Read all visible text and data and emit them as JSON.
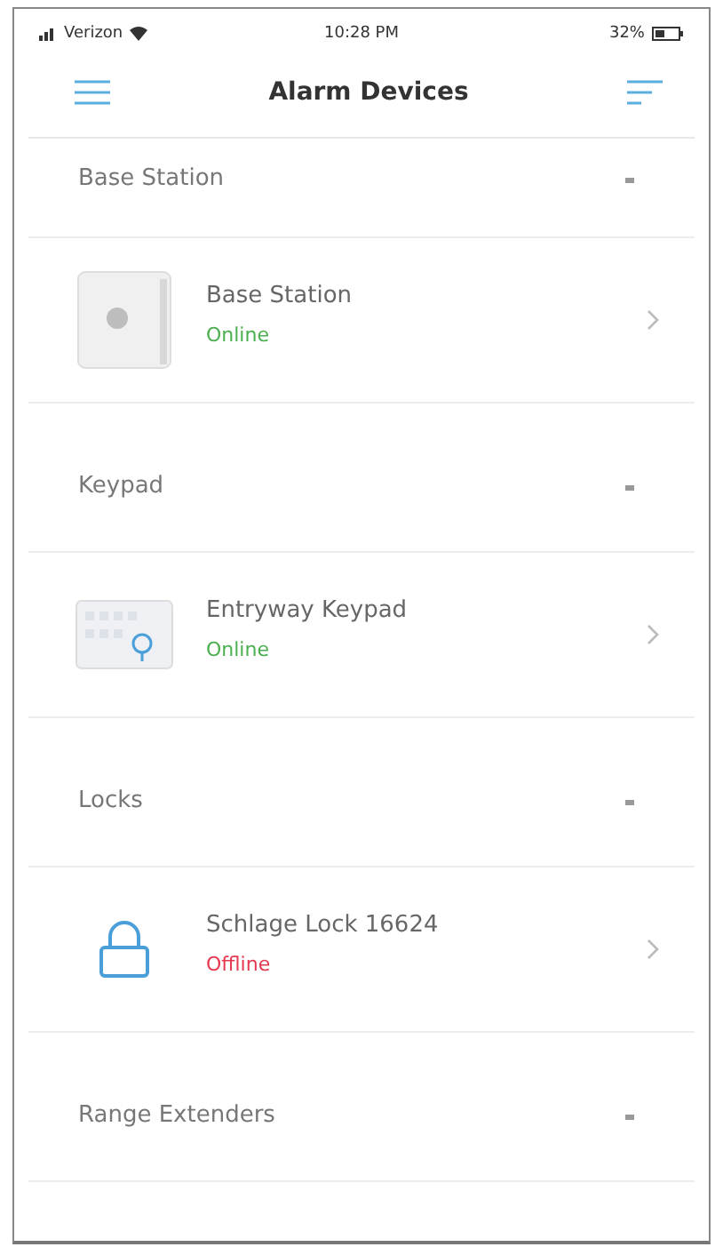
{
  "status_bar": {
    "carrier": "Verizon",
    "time": "10:28 PM",
    "battery": "32%"
  },
  "header": {
    "title": "Alarm Devices"
  },
  "sections": [
    {
      "title": "Base Station",
      "devices": [
        {
          "kind": "base",
          "name": "Base Station",
          "status": "Online",
          "online": true
        }
      ]
    },
    {
      "title": "Keypad",
      "devices": [
        {
          "kind": "keypad",
          "name": "Entryway Keypad",
          "status": "Online",
          "online": true
        }
      ]
    },
    {
      "title": "Locks",
      "devices": [
        {
          "kind": "lock",
          "name": "Schlage Lock 16624",
          "status": "Offline",
          "online": false
        }
      ]
    },
    {
      "title": "Range Extenders"
    }
  ]
}
